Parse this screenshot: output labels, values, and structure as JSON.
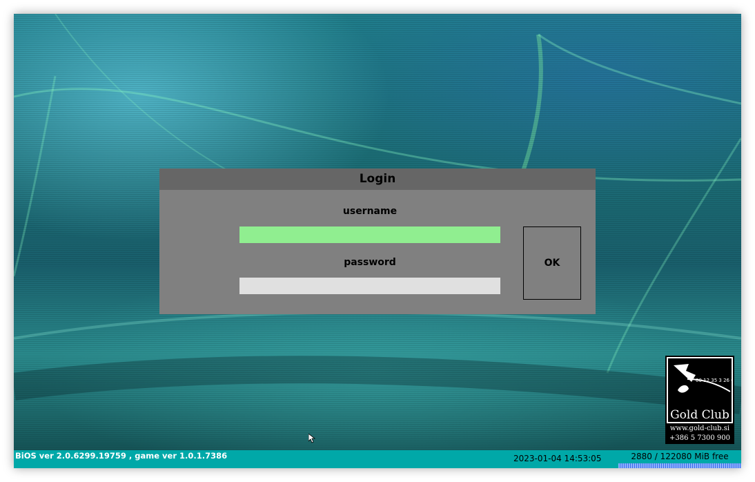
{
  "dialog": {
    "title": "Login",
    "username_label": "username",
    "password_label": "password",
    "username_value": "",
    "password_value": "",
    "ok_label": "OK"
  },
  "logo": {
    "name": "Gold Club",
    "website": "www.gold-club.si",
    "phone": "+386 5 7300 900"
  },
  "status_bar": {
    "version_text": "BiOS ver 2.0.6299.19759 , game ver 1.0.1.7386",
    "datetime": "2023-01-04 14:53:05",
    "disk_text": "2880 / 122080 MiB free",
    "disk_free_fraction": 0.0236
  },
  "colors": {
    "username_field": "#90ee90",
    "password_field": "#e0e0e0",
    "dialog_bg": "#808080",
    "dialog_title_bg": "#666666",
    "status_bar_bg": "#00a8a8"
  }
}
